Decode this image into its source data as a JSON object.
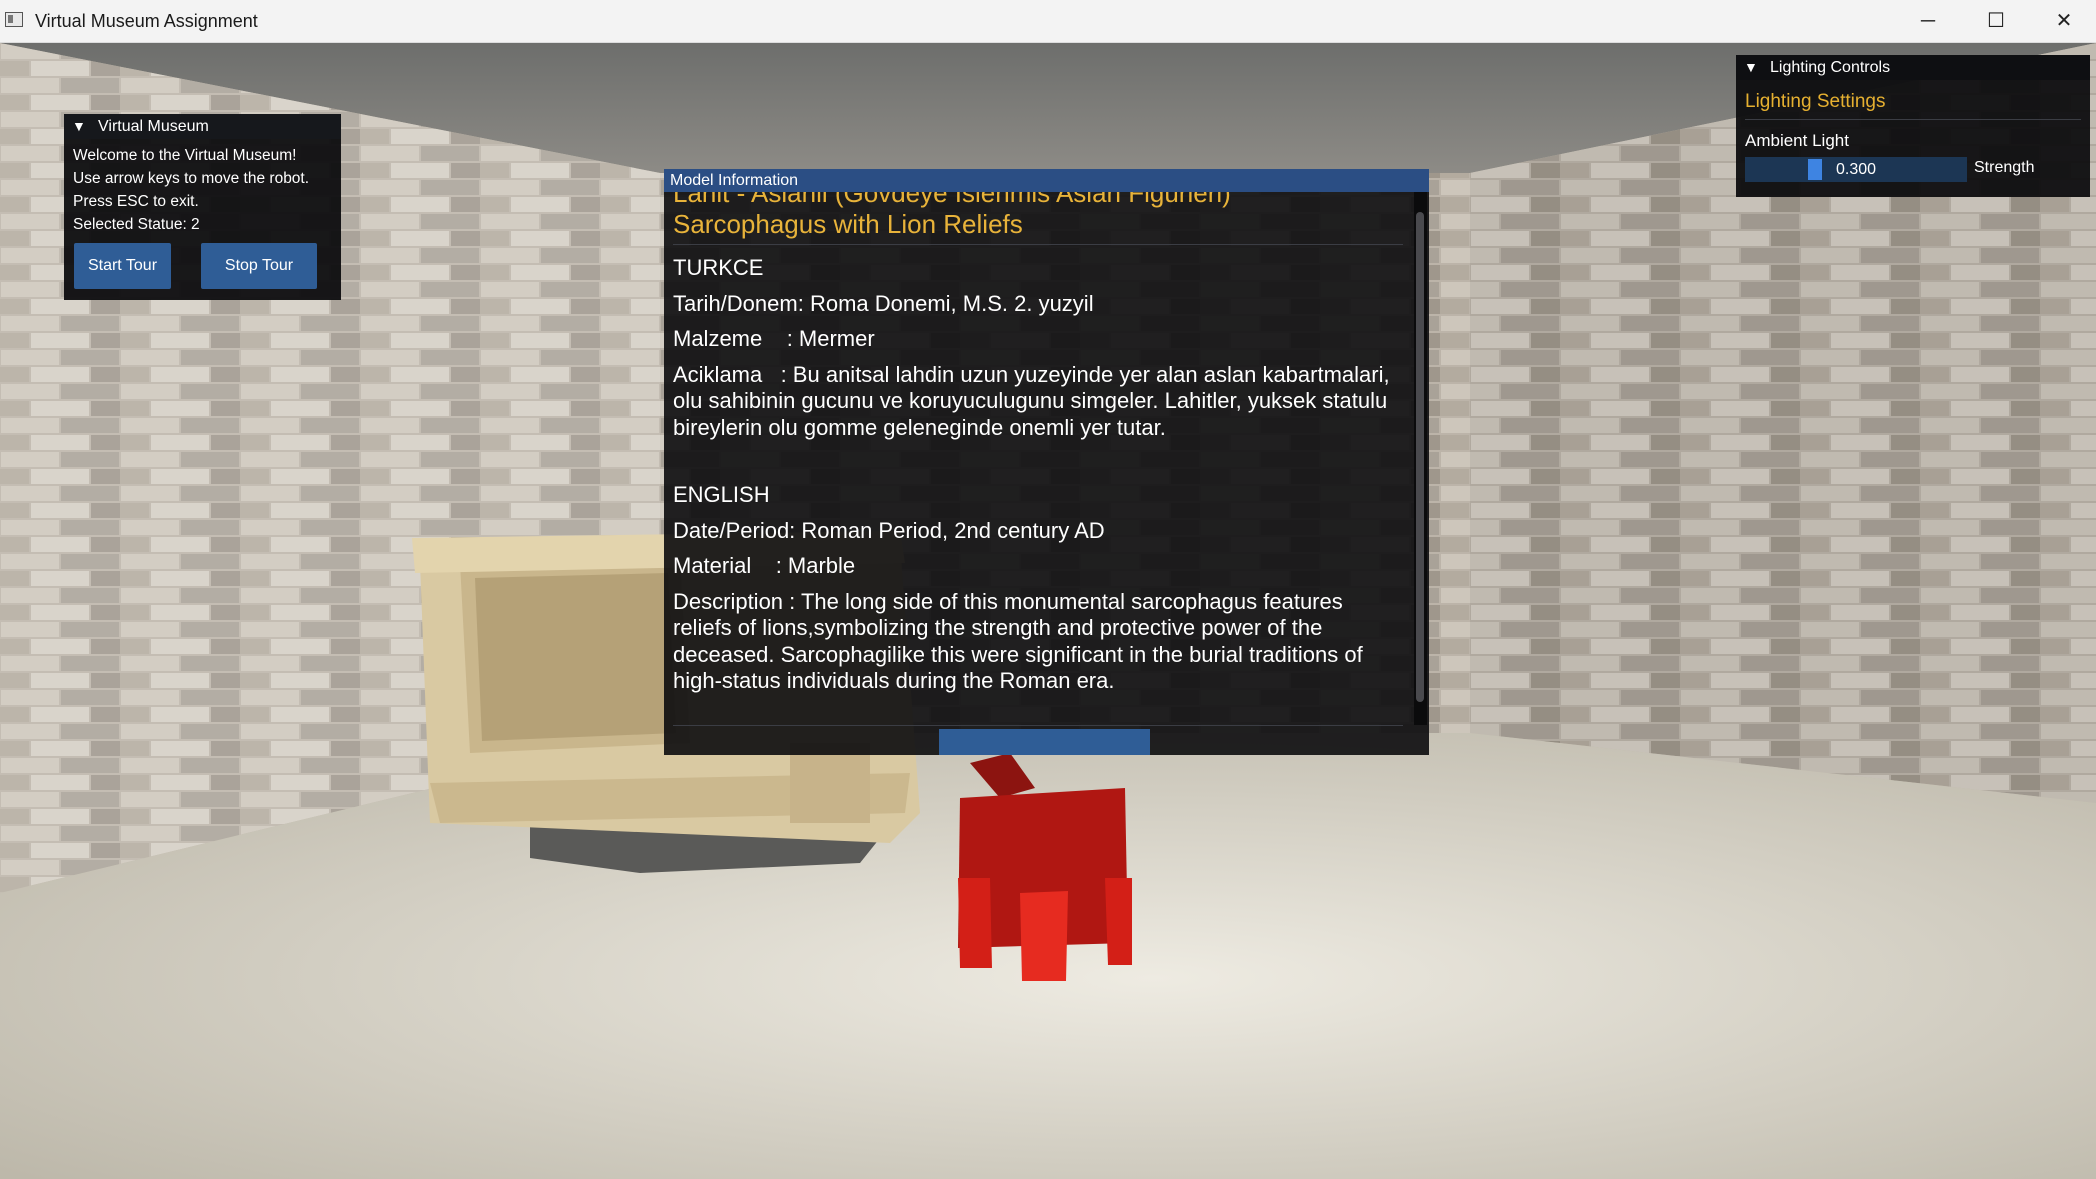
{
  "window": {
    "title": "Virtual Museum Assignment",
    "min_glyph": "─",
    "max_glyph": "☐",
    "close_glyph": "✕"
  },
  "museum_panel": {
    "header": "Virtual Museum",
    "lines": [
      "Welcome to the Virtual Museum!",
      "Use arrow keys to move the robot.",
      "Press ESC to exit.",
      "Selected Statue: 2"
    ],
    "start_label": "Start Tour",
    "stop_label": "Stop Tour"
  },
  "lighting_panel": {
    "header": "Lighting Controls",
    "subtitle": "Lighting Settings",
    "ambient_label": "Ambient Light",
    "ambient_value": "0.300",
    "ambient_fraction": 0.3,
    "strength_label": "Strength"
  },
  "info_panel": {
    "header": "Model Information",
    "title_tr": "Lahit - Aslanli (Govdeye Islenmis Aslan Figurleri)",
    "title_en": "Sarcophagus with Lion Reliefs",
    "turkce_heading": "TURKCE",
    "tr_date": "Tarih/Donem: Roma Donemi, M.S. 2. yuzyil",
    "tr_material": "Malzeme    : Mermer",
    "tr_desc": "Aciklama   : Bu anitsal lahdin uzun yuzeyinde yer alan aslan kabartmalari, olu sahibinin gucunu ve koruyuculugunu simgeler. Lahitler, yuksek statulu bireylerin olu gomme geleneginde onemli yer tutar.",
    "english_heading": "ENGLISH",
    "en_date": "Date/Period: Roman Period, 2nd century AD",
    "en_material": "Material    : Marble",
    "en_desc": "Description : The long side of this monumental sarcophagus features reliefs of lions,symbolizing the strength and protective power of the deceased. Sarcophagilike this were significant in the burial traditions of high-status individuals during the Roman era."
  },
  "colors": {
    "panel_bg": "#0c0c0e",
    "accent_blue": "#2f5d96",
    "title_gold": "#e8b33a",
    "robot_red": "#b01712"
  }
}
